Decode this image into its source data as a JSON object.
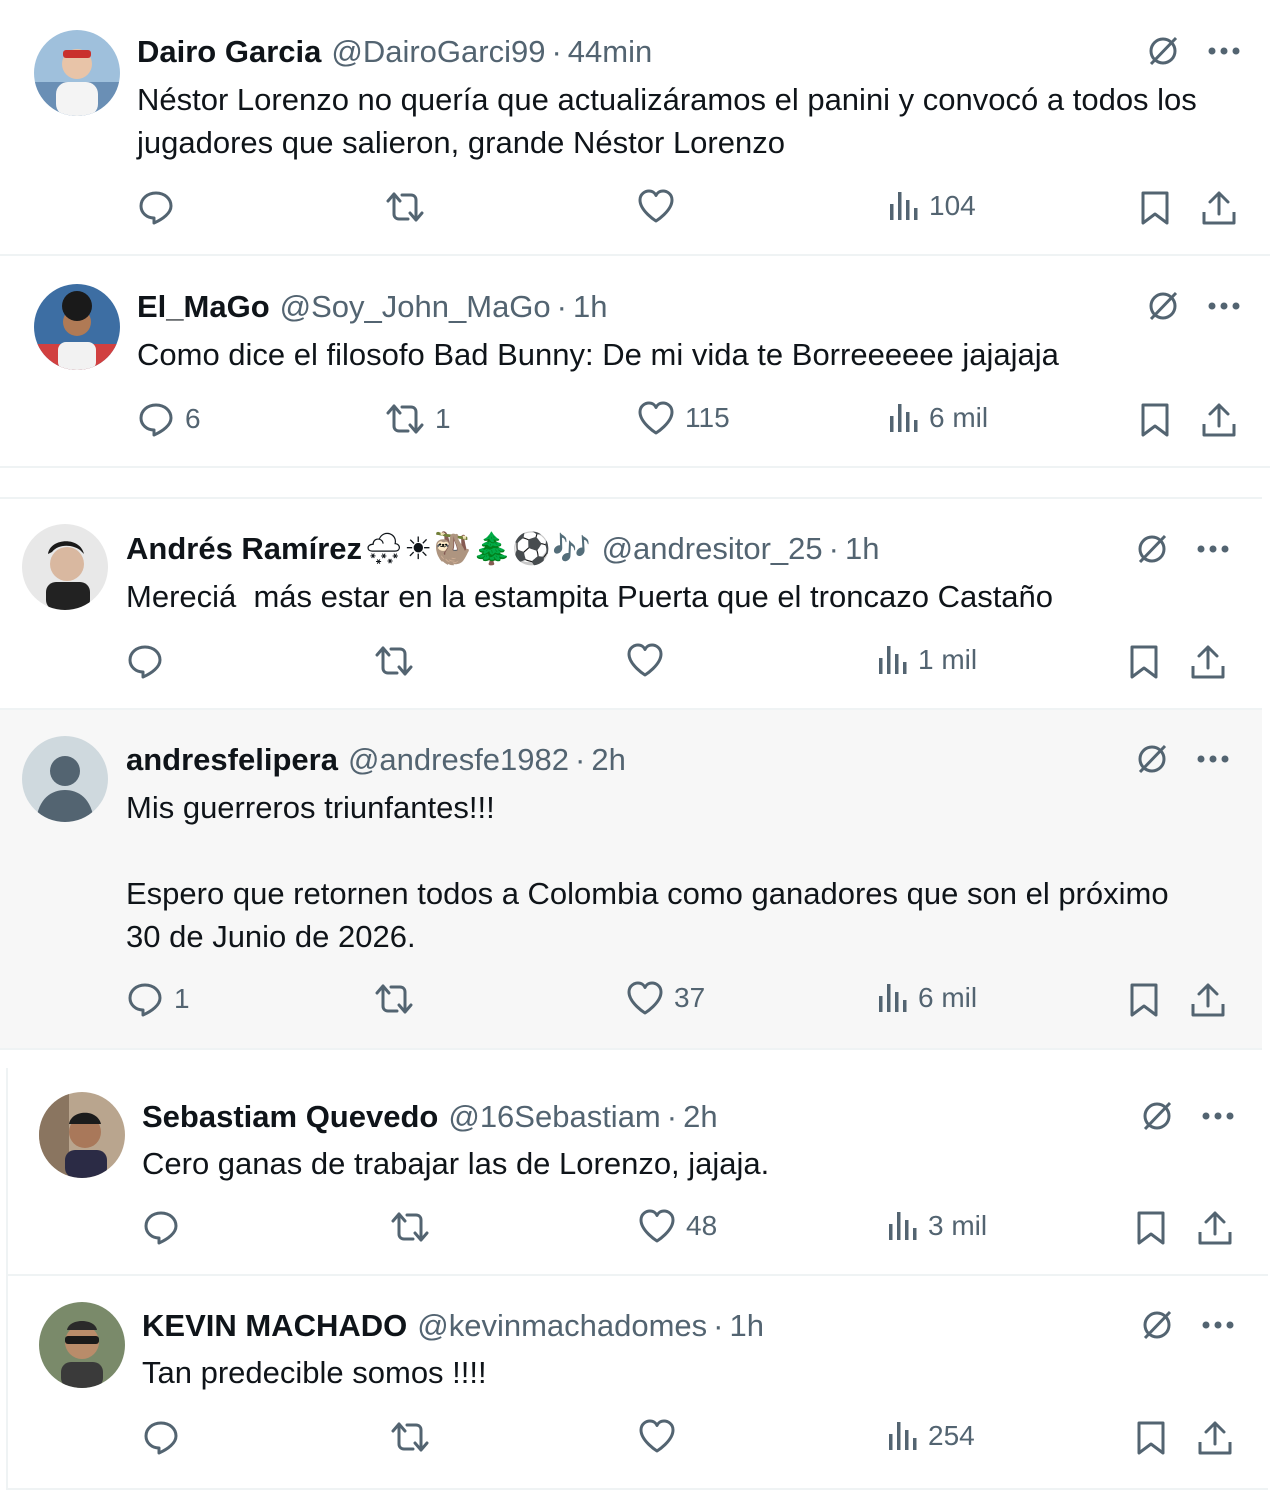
{
  "tweets": [
    {
      "name": "Dairo Garcia",
      "emoji": "",
      "handle": "@DairoGarci99",
      "time": "44min",
      "text": "Néstor Lorenzo no quería que actualizáramos el panini y convocó a todos los\njugadores que salieron, grande Néstor Lorenzo",
      "replies": "",
      "retweets": "",
      "likes": "",
      "views": "104",
      "avatar_color": "#6a8fb5"
    },
    {
      "name": "El_MaGo",
      "emoji": "",
      "handle": "@Soy_John_MaGo",
      "time": "1h",
      "text": "Como dice el filosofo Bad Bunny: De mi vida te Borreeeeee jajajaja",
      "replies": "6",
      "retweets": "1",
      "likes": "115",
      "views": "6 mil",
      "avatar_color": "#c8323a"
    },
    {
      "name": "Andrés Ramírez",
      "emoji": "🌨☀🦥🌲⚽🎶",
      "handle": "@andresitor_25",
      "time": "1h",
      "text": "Mereciá  más estar en la estampita Puerta que el troncazo Castaño",
      "replies": "",
      "retweets": "",
      "likes": "",
      "views": "1 mil",
      "avatar_color": "#3a3a3a"
    },
    {
      "name": "andresfelipera",
      "emoji": "",
      "handle": "@andresfe1982",
      "time": "2h",
      "text": "Mis guerreros triunfantes!!!\n\nEspero que retornen todos a Colombia como ganadores que son el próximo\n30 de Junio de 2026.",
      "replies": "1",
      "retweets": "",
      "likes": "37",
      "views": "6 mil",
      "avatar_color": "#cfd9de"
    },
    {
      "name": "Sebastiam Quevedo",
      "emoji": "",
      "handle": "@16Sebastiam",
      "time": "2h",
      "text": "Cero ganas de trabajar las de Lorenzo, jajaja.",
      "replies": "",
      "retweets": "",
      "likes": "48",
      "views": "3 mil",
      "avatar_color": "#5a4638"
    },
    {
      "name": "KEVIN MACHADO",
      "emoji": "",
      "handle": "@kevinmachadomes",
      "time": "1h",
      "text": "Tan predecible somos !!!!",
      "replies": "",
      "retweets": "",
      "likes": "",
      "views": "254",
      "avatar_color": "#4d5a4a"
    }
  ]
}
